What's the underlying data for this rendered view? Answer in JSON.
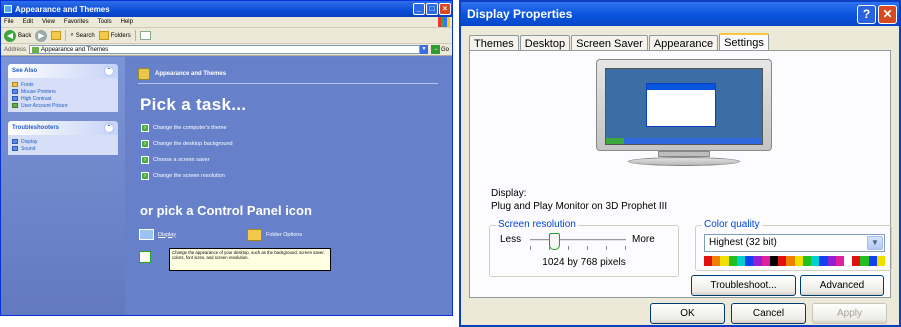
{
  "left_window": {
    "title": "Appearance and Themes",
    "menu": [
      "File",
      "Edit",
      "View",
      "Favorites",
      "Tools",
      "Help"
    ],
    "toolbar": {
      "back": "Back",
      "search": "Search",
      "folders": "Folders"
    },
    "address": {
      "label": "Address",
      "value": "Appearance and Themes",
      "go": "Go"
    },
    "see_also": {
      "header": "See Also",
      "items": [
        "Fonts",
        "Mouse Pointers",
        "High Contrast",
        "User Account Picture"
      ]
    },
    "troubleshooters": {
      "header": "Troubleshooters",
      "items": [
        "Display",
        "Sound"
      ]
    },
    "category_title": "Appearance and Themes",
    "pick_task": "Pick a task...",
    "tasks": [
      "Change the computer's theme",
      "Change the desktop background",
      "Choose a screen saver",
      "Change the screen resolution"
    ],
    "pick_icon": "or pick a Control Panel icon",
    "icons": {
      "display": "Display",
      "folder_options": "Folder Options"
    },
    "tooltip": "Change the appearance of your desktop, such as the background, screen saver, colors, font sizes, and screen resolution."
  },
  "right_window": {
    "title": "Display Properties",
    "title_buttons": {
      "help": "?",
      "close": "✕"
    },
    "tabs": [
      "Themes",
      "Desktop",
      "Screen Saver",
      "Appearance",
      "Settings"
    ],
    "active_tab": "Settings",
    "display_label": "Display:",
    "display_value": "Plug and Play Monitor on 3D Prophet III",
    "resolution": {
      "legend": "Screen resolution",
      "less": "Less",
      "more": "More",
      "value": "1024 by 768 pixels",
      "level": 0.2
    },
    "color_quality": {
      "legend": "Color quality",
      "selected": "Highest (32 bit)"
    },
    "buttons": {
      "troubleshoot": "Troubleshoot...",
      "advanced": "Advanced",
      "ok": "OK",
      "cancel": "Cancel",
      "apply": "Apply"
    },
    "color_bar": [
      "#e01010",
      "#f08000",
      "#f0e000",
      "#20c020",
      "#00d0d0",
      "#1040f0",
      "#9020d0",
      "#e020a0",
      "#000000",
      "#e01010",
      "#f08000",
      "#f0e000",
      "#20c020",
      "#00d0d0",
      "#1040f0",
      "#9020d0",
      "#e020a0",
      "#ffffff",
      "#e01010",
      "#20c020",
      "#1040f0",
      "#f0e000"
    ]
  }
}
